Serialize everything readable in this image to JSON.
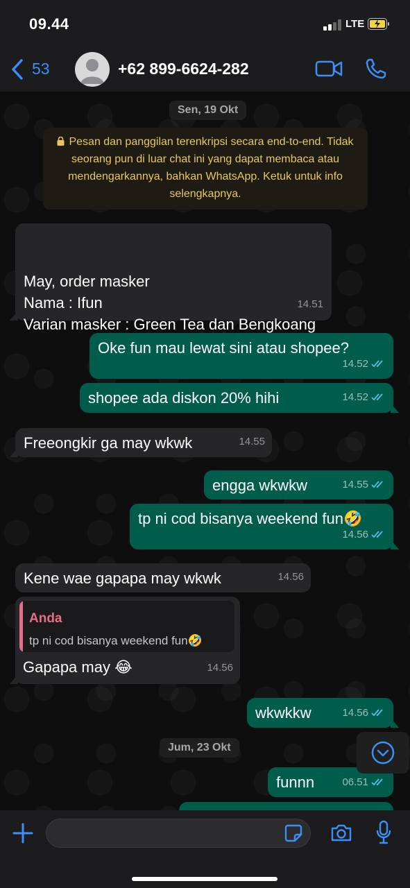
{
  "status_bar": {
    "time": "09.44",
    "network": "LTE"
  },
  "header": {
    "back_count": "53",
    "contact": "+62 899-6624-282"
  },
  "date_1": "Sen, 19 Okt",
  "encryption_notice": "Pesan dan panggilan terenkripsi secara end-to-end. Tidak seorang pun di luar chat ini yang dapat membaca atau mendengarkannya, bahkan WhatsApp. Ketuk untuk info selengkapnya.",
  "messages": [
    {
      "dir": "in",
      "text": "May, order masker\nNama : Ifun\nVarian masker : Green Tea dan Bengkoang",
      "time": "14.51"
    },
    {
      "dir": "out",
      "text": "Oke fun mau lewat sini atau shopee?",
      "time": "14.52"
    },
    {
      "dir": "out",
      "text": "shopee ada diskon 20% hihi",
      "time": "14.52"
    },
    {
      "dir": "in",
      "text": "Freeongkir ga may wkwk",
      "time": "14.55"
    },
    {
      "dir": "out",
      "text": "engga wkwkw",
      "time": "14.55"
    },
    {
      "dir": "out",
      "text": "tp ni cod bisanya weekend fun🤣",
      "time": "14.56"
    },
    {
      "dir": "in",
      "text": "Kene wae gapapa may wkwk",
      "time": "14.56"
    },
    {
      "dir": "in",
      "text": "Gapapa may 😂",
      "time": "14.56",
      "quote": {
        "name": "Anda",
        "text": "tp ni cod bisanya weekend fun🤣"
      }
    },
    {
      "dir": "out",
      "text": "wkwkkw",
      "time": "14.56"
    },
    {
      "dir": "out",
      "text": "funnn",
      "time": "06.51"
    }
  ],
  "date_2": "Jum, 23 Okt",
  "composer": {
    "placeholder": ""
  },
  "colors": {
    "accent": "#3b8ff6",
    "outgoing": "#005c4b",
    "incoming": "#262628",
    "read_ticks": "#53bdeb"
  }
}
